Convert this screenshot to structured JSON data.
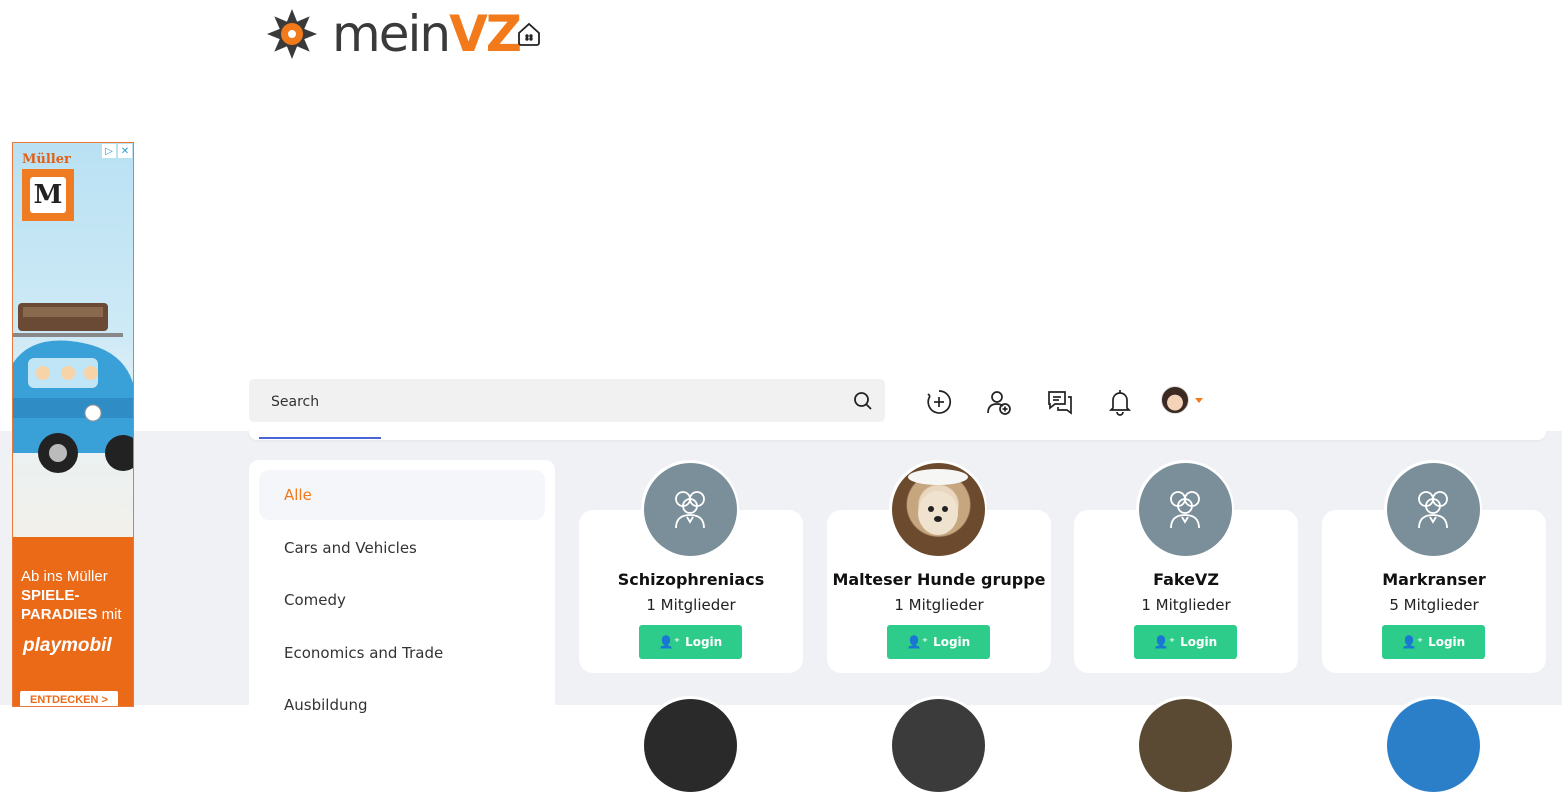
{
  "header": {
    "logo_part1": "mein",
    "logo_part2": "VZ",
    "home_icon": "home-icon"
  },
  "ad": {
    "brand": "Müller",
    "badge_letter": "M",
    "line1": "Ab ins Müller",
    "line2": "SPIELE-",
    "line3": "PARADIES",
    "line3_suffix": " mit",
    "logo_text": "playmobil",
    "cta": "ENTDECKEN >"
  },
  "toolbar": {
    "search_placeholder": "Search",
    "icons": [
      "add-circle-icon",
      "add-user-icon",
      "messages-icon",
      "bell-icon"
    ]
  },
  "categories": [
    {
      "label": "Alle",
      "active": true
    },
    {
      "label": "Cars and Vehicles",
      "active": false
    },
    {
      "label": "Comedy",
      "active": false
    },
    {
      "label": "Economics and Trade",
      "active": false
    },
    {
      "label": "Ausbildung",
      "active": false
    }
  ],
  "groups": [
    {
      "name": "Schizophreniacs",
      "members": "1 Mitglieder",
      "button": "Login",
      "avatar": "group-placeholder"
    },
    {
      "name": "Malteser Hunde gruppe",
      "members": "1 Mitglieder",
      "button": "Login",
      "avatar": "dog-photo"
    },
    {
      "name": "FakeVZ",
      "members": "1 Mitglieder",
      "button": "Login",
      "avatar": "group-placeholder"
    },
    {
      "name": "Markranser",
      "members": "5 Mitglieder",
      "button": "Login",
      "avatar": "group-placeholder"
    }
  ],
  "colors": {
    "brand_orange": "#f27a1a",
    "login_green": "#2ecc8a",
    "placeholder_avatar": "#7a8f99",
    "page_gray": "#f0f1f5",
    "tab_blue": "#4a63d6"
  }
}
